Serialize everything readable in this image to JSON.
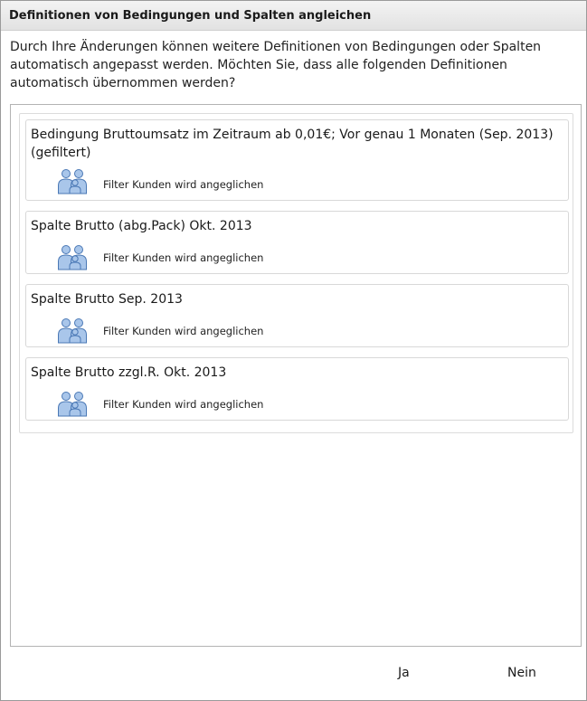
{
  "dialog": {
    "title": "Definitionen von Bedingungen und Spalten angleichen",
    "intro": "Durch Ihre Änderungen können weitere Definitionen von Bedingungen oder Spalten automatisch angepasst werden. Möchten Sie, dass alle folgenden Definitionen automatisch übernommen werden?"
  },
  "items": [
    {
      "title": "Bedingung Bruttoumsatz im Zeitraum ab 0,01€; Vor genau 1 Monaten  (Sep. 2013) (gefiltert)",
      "status": "Filter Kunden wird angeglichen",
      "icon": "customers-group-icon"
    },
    {
      "title": "Spalte Brutto (abg.Pack) Okt. 2013",
      "status": "Filter Kunden wird angeglichen",
      "icon": "customers-group-icon"
    },
    {
      "title": "Spalte Brutto Sep. 2013",
      "status": "Filter Kunden wird angeglichen",
      "icon": "customers-group-icon"
    },
    {
      "title": "Spalte Brutto zzgl.R. Okt. 2013",
      "status": "Filter Kunden wird angeglichen",
      "icon": "customers-group-icon"
    }
  ],
  "buttons": {
    "yes": "Ja",
    "no": "Nein"
  },
  "colors": {
    "icon_fill": "#a9c6ea",
    "icon_stroke": "#4a78b5"
  }
}
